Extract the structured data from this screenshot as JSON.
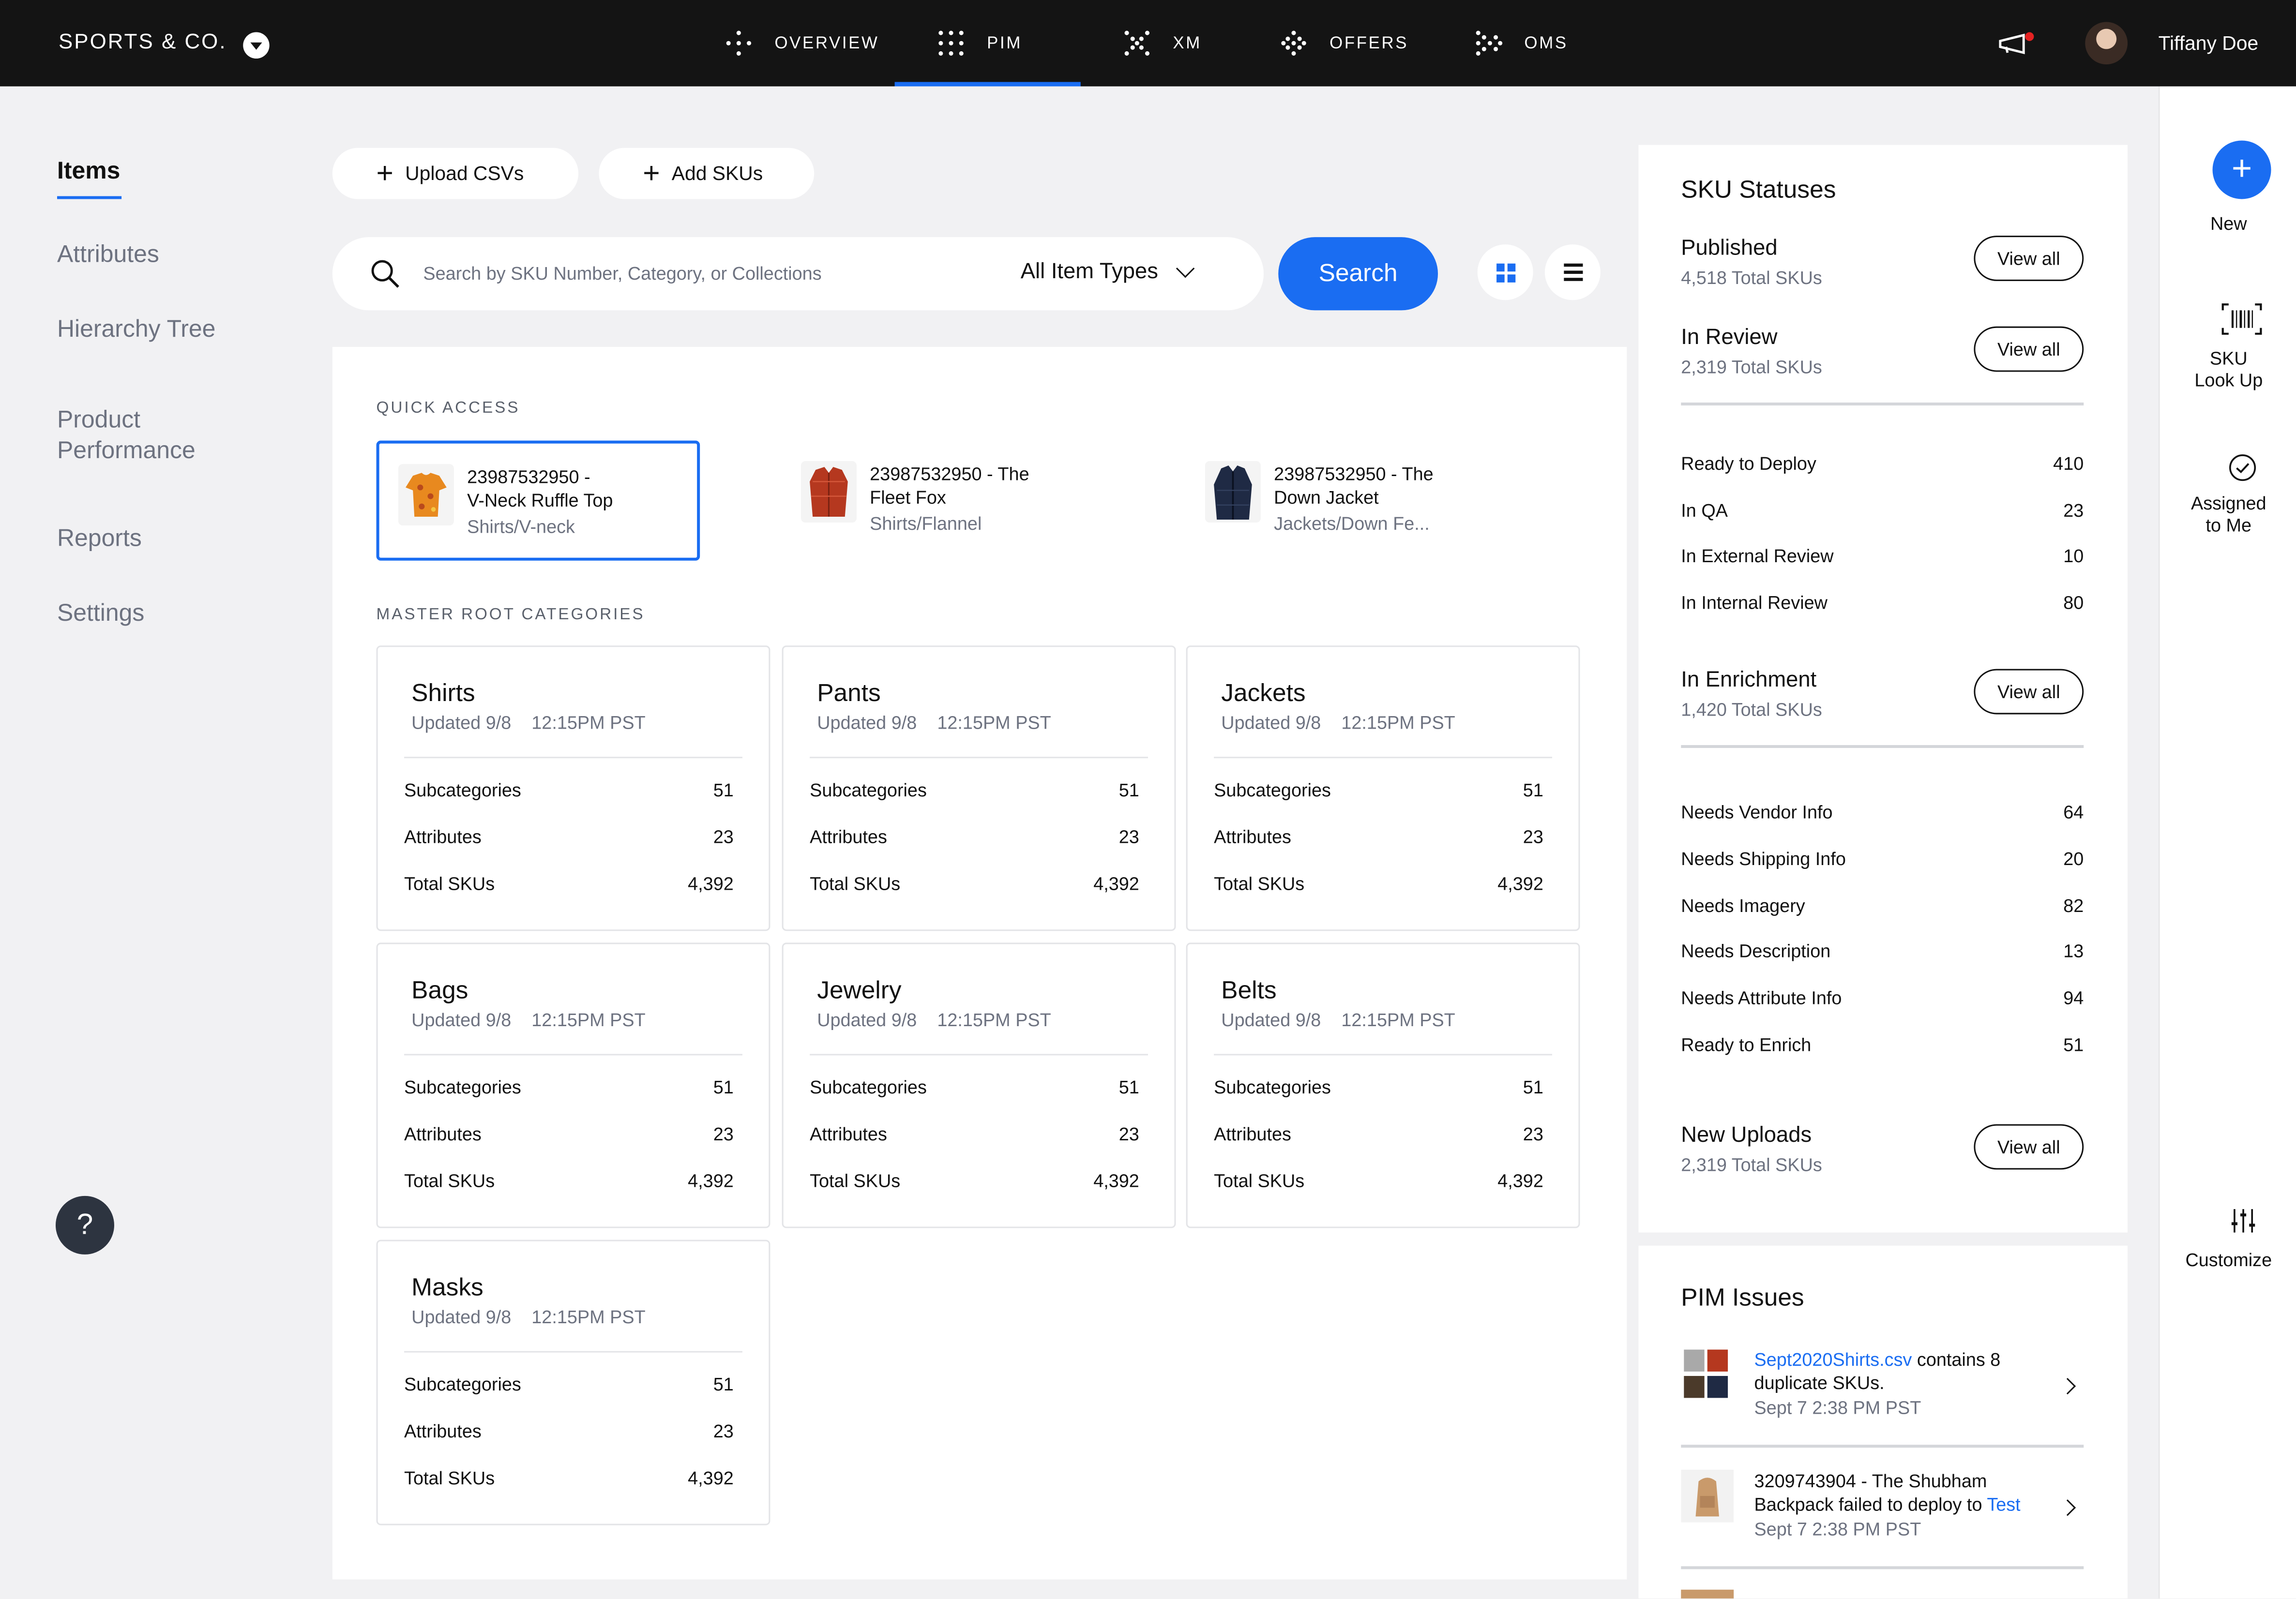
{
  "header": {
    "brand": "SPORTS & CO.",
    "nav": [
      {
        "label": "OVERVIEW"
      },
      {
        "label": "PIM"
      },
      {
        "label": "XM"
      },
      {
        "label": "OFFERS"
      },
      {
        "label": "OMS"
      }
    ],
    "active_nav": "PIM",
    "user_name": "Tiffany Doe"
  },
  "sidebar": {
    "items": [
      {
        "label": "Items"
      },
      {
        "label": "Attributes"
      },
      {
        "label": "Hierarchy Tree"
      },
      {
        "label": "Product\nPerformance"
      },
      {
        "label": "Reports"
      },
      {
        "label": "Settings"
      }
    ],
    "help_label": "?"
  },
  "actions": {
    "upload_label": "Upload CSVs",
    "add_label": "Add SKUs"
  },
  "search": {
    "placeholder": "Search by SKU Number, Category, or Collections",
    "type_filter": "All Item Types",
    "button_label": "Search"
  },
  "quick_access": {
    "label": "QUICK ACCESS",
    "items": [
      {
        "title": "23987532950 -\nV-Neck Ruffle Top",
        "sub": "Shirts/V-neck"
      },
      {
        "title": "23987532950 - The\nFleet Fox",
        "sub": "Shirts/Flannel"
      },
      {
        "title": "23987532950 - The\nDown Jacket",
        "sub": "Jackets/Down Fe..."
      }
    ]
  },
  "categories": {
    "label": "MASTER ROOT CATEGORIES",
    "row_labels": {
      "subcategories": "Subcategories",
      "attributes": "Attributes",
      "total_skus": "Total SKUs"
    },
    "items": [
      {
        "name": "Shirts",
        "updated": "Updated 9/8    12:15PM PST",
        "subcategories": "51",
        "attributes": "23",
        "total_skus": "4,392"
      },
      {
        "name": "Pants",
        "updated": "Updated 9/8    12:15PM PST",
        "subcategories": "51",
        "attributes": "23",
        "total_skus": "4,392"
      },
      {
        "name": "Jackets",
        "updated": "Updated 9/8    12:15PM PST",
        "subcategories": "51",
        "attributes": "23",
        "total_skus": "4,392"
      },
      {
        "name": "Bags",
        "updated": "Updated 9/8    12:15PM PST",
        "subcategories": "51",
        "attributes": "23",
        "total_skus": "4,392"
      },
      {
        "name": "Jewelry",
        "updated": "Updated 9/8    12:15PM PST",
        "subcategories": "51",
        "attributes": "23",
        "total_skus": "4,392"
      },
      {
        "name": "Belts",
        "updated": "Updated 9/8    12:15PM PST",
        "subcategories": "51",
        "attributes": "23",
        "total_skus": "4,392"
      },
      {
        "name": "Masks",
        "updated": "Updated 9/8    12:15PM PST",
        "subcategories": "51",
        "attributes": "23",
        "total_skus": "4,392"
      }
    ]
  },
  "sku_statuses": {
    "title": "SKU Statuses",
    "view_all": "View all",
    "published": {
      "title": "Published",
      "sub": "4,518 Total SKUs"
    },
    "in_review": {
      "title": "In Review",
      "sub": "2,319 Total SKUs"
    },
    "review_rows": [
      {
        "label": "Ready to Deploy",
        "value": "410"
      },
      {
        "label": "In QA",
        "value": "23"
      },
      {
        "label": "In External Review",
        "value": "10"
      },
      {
        "label": "In Internal Review",
        "value": "80"
      }
    ],
    "in_enrichment": {
      "title": "In Enrichment",
      "sub": "1,420 Total SKUs"
    },
    "enrichment_rows": [
      {
        "label": "Needs Vendor Info",
        "value": "64"
      },
      {
        "label": "Needs Shipping Info",
        "value": "20"
      },
      {
        "label": "Needs Imagery",
        "value": "82"
      },
      {
        "label": "Needs Description",
        "value": "13"
      },
      {
        "label": "Needs Attribute Info",
        "value": "94"
      },
      {
        "label": "Ready to Enrich",
        "value": "51"
      }
    ],
    "new_uploads": {
      "title": "New Uploads",
      "sub": "2,319 Total SKUs"
    }
  },
  "pim_issues": {
    "title": "PIM Issues",
    "items": [
      {
        "link": "Sept2020Shirts.csv",
        "text": " contains 8 duplicate SKUs.",
        "time": "Sept 7 2:38 PM PST"
      },
      {
        "text_before": "3209743904 - The Shubham Backpack failed to deploy to ",
        "link": "Test",
        "time": "Sept 7 2:38 PM PST"
      }
    ]
  },
  "rail": {
    "new_label": "New",
    "sku_lookup_label": "SKU\nLook Up",
    "assigned_label": "Assigned\nto Me",
    "customize_label": "Customize"
  },
  "colors": {
    "accent": "#1a6df2",
    "topbar": "#141414",
    "background": "#f1f1f3"
  }
}
